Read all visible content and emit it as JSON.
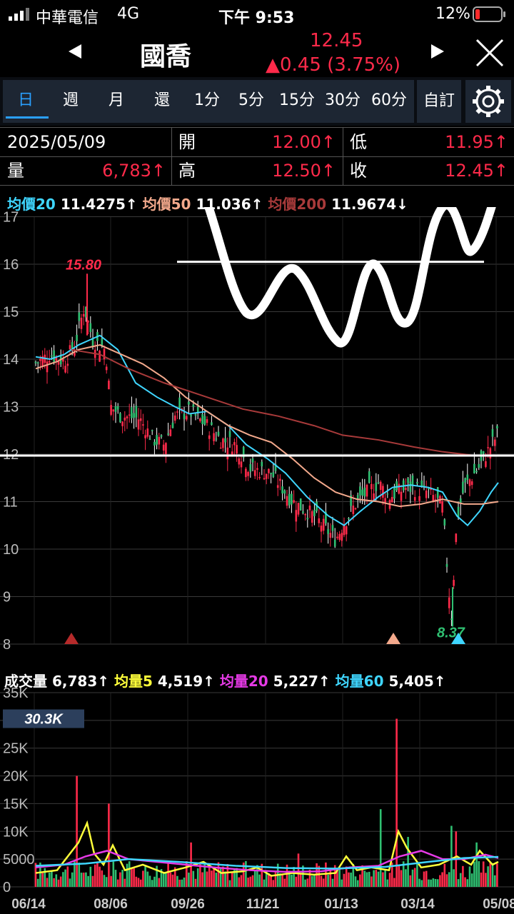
{
  "status": {
    "carrier": "中華電信",
    "network": "4G",
    "time": "下午 9:53",
    "battery": "12%"
  },
  "header": {
    "title": "國喬",
    "price": "12.45",
    "change": "▲0.45 (3.75%)",
    "prev_icon": "left-triangle-icon",
    "next_icon": "right-triangle-icon",
    "close_icon": "close-icon"
  },
  "tabs": [
    "日",
    "週",
    "月",
    "還",
    "1分",
    "5分",
    "15分",
    "30分",
    "60分"
  ],
  "custom_btn": "自訂",
  "settings_icon": "gear-icon",
  "info": {
    "date": "2025/05/09",
    "open_label": "開",
    "open_value": "12.00↑",
    "low_label": "低",
    "low_value": "11.95↑",
    "vol_label": "量",
    "vol_value": "6,783↑",
    "high_label": "高",
    "high_value": "12.50↑",
    "close_label": "收",
    "close_value": "12.45↑"
  },
  "ma_legend": {
    "ma20_label": "均價20",
    "ma20_value": "11.4275↑",
    "ma50_label": "均價50",
    "ma50_value": "11.036↑",
    "ma200_label": "均價200",
    "ma200_value": "11.9674↓"
  },
  "price_axis": [
    "17",
    "16",
    "15",
    "14",
    "13",
    "12",
    "11",
    "10",
    "9",
    "8"
  ],
  "high_label": "15.80",
  "low_label": "8.37",
  "volume_legend": {
    "vol_label": "成交量",
    "vol_value": "6,783↑",
    "avg5_label": "均量5",
    "avg5_value": "4,519↑",
    "avg20_label": "均量20",
    "avg20_value": "5,227↑",
    "avg60_label": "均量60",
    "avg60_value": "5,405↑"
  },
  "volume_axis": [
    "35K",
    "30K",
    "25K",
    "20K",
    "15K",
    "10K",
    "5000",
    "0"
  ],
  "volume_marker": "30.3K",
  "date_axis": [
    "06/14",
    "08/06",
    "09/26",
    "11/21",
    "01/13",
    "03/14",
    "05/08"
  ],
  "colors": {
    "up": "#ff2a4a",
    "down": "#2fbf71",
    "ma20": "#3fd6ff",
    "ma50": "#f3a98c",
    "ma200": "#a83a3a",
    "avg5": "#ffff3a",
    "avg20": "#e63ae6",
    "avg60": "#3fd6ff",
    "accent": "#2aa0ff"
  }
}
